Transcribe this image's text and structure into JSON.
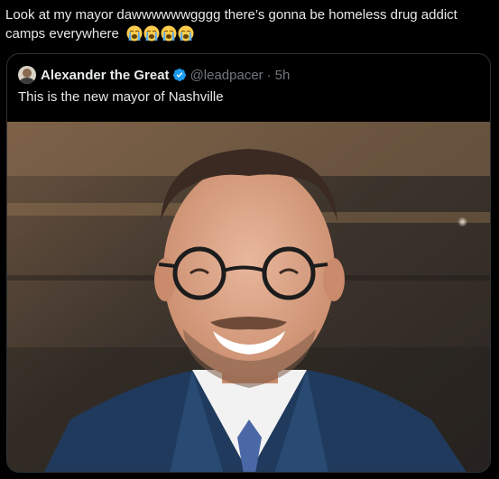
{
  "post": {
    "text": "Look at my mayor dawwwwwwgggg there’s gonna be homeless drug addict camps everywhere",
    "emojis": [
      "loudly-crying-face",
      "loudly-crying-face",
      "loudly-crying-face",
      "loudly-crying-face"
    ]
  },
  "quote": {
    "author_name": "Alexander the Great",
    "verified": true,
    "handle": "@leadpacer",
    "separator": "·",
    "time": "5h",
    "text": "This is the new mayor of Nashville",
    "media_description": "photo"
  },
  "colors": {
    "background": "#000000",
    "text": "#e7e9ea",
    "muted": "#71767b",
    "border": "#2f3336",
    "verified": "#1d9bf0",
    "emoji": "#ffcc4d"
  }
}
